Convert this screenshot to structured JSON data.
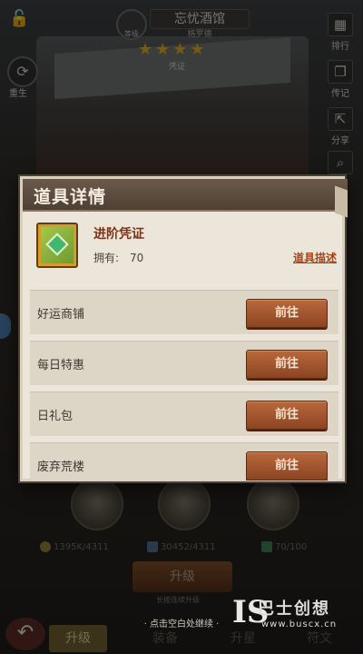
{
  "header": {
    "shop_title": "忘忧酒馆",
    "shop_subtitle": "格罗德",
    "level_label": "等级",
    "stars_label": "凭证",
    "star_count": 4
  },
  "left_controls": {
    "reset_label": "重生"
  },
  "right_controls": [
    {
      "icon": "ranking-icon",
      "label": "排行"
    },
    {
      "icon": "legend-book-icon",
      "label": "传记"
    },
    {
      "icon": "share-icon",
      "label": "分享"
    },
    {
      "icon": "search-icon",
      "label": ""
    }
  ],
  "dialog": {
    "title": "道具详情",
    "item": {
      "name": "进阶凭证",
      "owned_label": "拥有:",
      "owned_value": "70",
      "desc_link": "道具描述",
      "icon": "certificate-icon"
    },
    "sources": [
      {
        "label": "好运商铺",
        "button": "前往"
      },
      {
        "label": "每日特惠",
        "button": "前往"
      },
      {
        "label": "日礼包",
        "button": "前往"
      },
      {
        "label": "废弃荒楼",
        "button": "前往"
      }
    ]
  },
  "resources": [
    {
      "icon": "coin-icon",
      "value": "1395K/4311"
    },
    {
      "icon": "gem-icon",
      "value": "30452/4311"
    },
    {
      "icon": "certificate-icon",
      "value": "70/100"
    }
  ],
  "upgrade_button": "升级",
  "upgrade_hint": "长按连续升级",
  "continue_hint": "· 点击空白处继续 ·",
  "bottom_nav": {
    "tabs": [
      "升级",
      "装备",
      "升星",
      "符文"
    ]
  },
  "watermark": {
    "logo": "IS",
    "name": "巴士创想",
    "url": "www.buscx.cn"
  }
}
